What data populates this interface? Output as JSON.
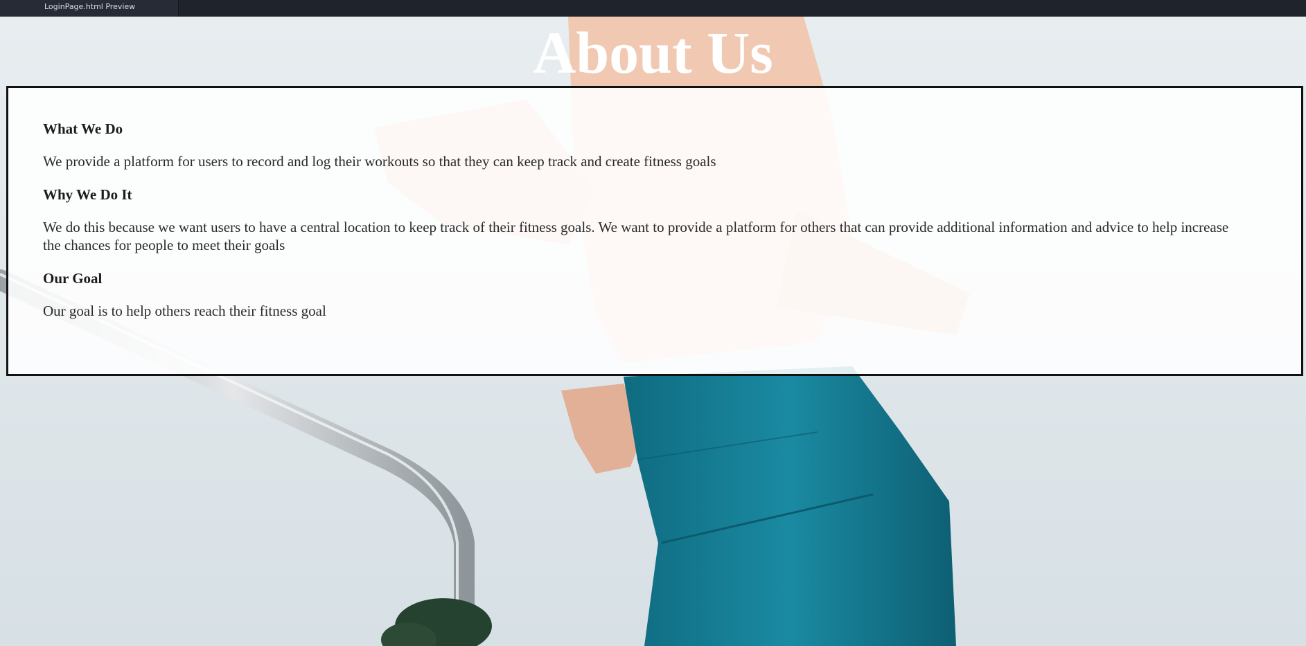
{
  "preview_tab": {
    "label": "LoginPage.html Preview"
  },
  "page": {
    "title": "About Us"
  },
  "sections": [
    {
      "heading": "What We Do",
      "text": "We provide a platform for users to record and log their workouts so that they can keep track and create fitness goals"
    },
    {
      "heading": "Why We Do It",
      "text": "We do this because we want users to have a central location to keep track of their fitness goals. We want to provide a platform for others that can provide additional information and advice to help increase the chances for people to meet their goals"
    },
    {
      "heading": "Our Goal",
      "text": "Our goal is to help others reach their fitness goal"
    }
  ],
  "colors": {
    "tabbar": "#1f232c",
    "box_border": "#111111",
    "title": "#ffffff",
    "leggings": "#137b92"
  }
}
